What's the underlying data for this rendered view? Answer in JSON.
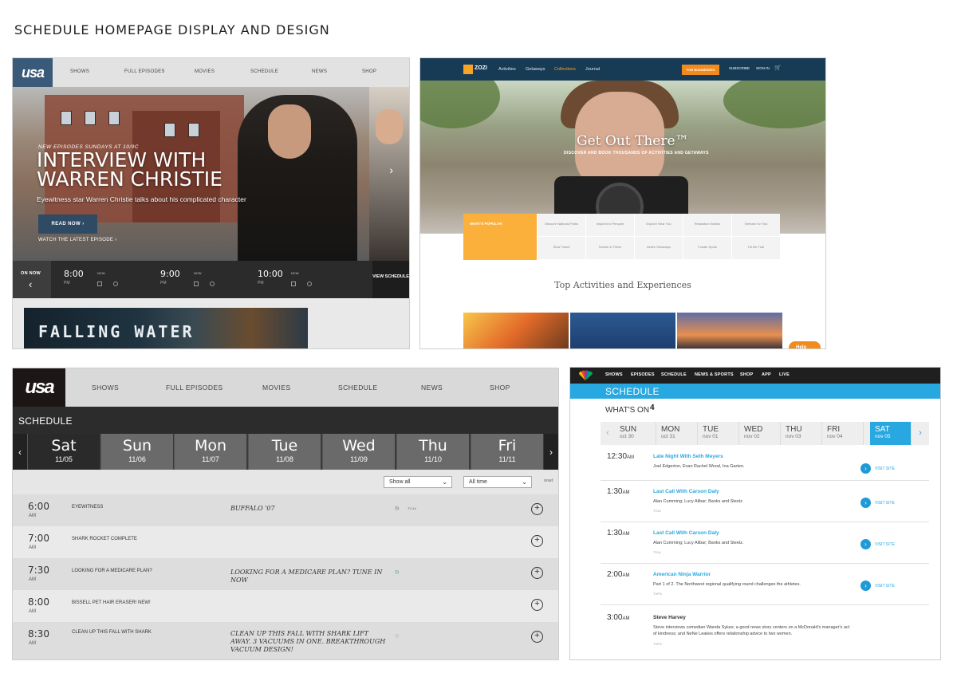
{
  "page": {
    "heading": "SCHEDULE HOMEPAGE DISPLAY AND DESIGN"
  },
  "usa_home": {
    "logo": "usa",
    "nav": [
      "SHOWS",
      "FULL EPISODES",
      "MOVIES",
      "SCHEDULE",
      "NEWS",
      "SHOP"
    ],
    "hero": {
      "kicker": "NEW EPISODES SUNDAYS AT 10/9C",
      "title": "INTERVIEW WITH WARREN CHRISTIE",
      "subtitle": "Eyewitness star Warren Christie talks about his complicated character",
      "read_now": "READ NOW",
      "watch_latest": "WATCH THE LATEST EPISODE"
    },
    "on_now": "ON NOW",
    "slots": [
      {
        "time": "8:00",
        "ampm": "PM",
        "tag": "NCW"
      },
      {
        "time": "9:00",
        "ampm": "PM",
        "tag": "NCW"
      },
      {
        "time": "10:00",
        "ampm": "PM",
        "tag": "NCW"
      }
    ],
    "view_schedule": "VIEW SCHEDULE",
    "banner": "FALLING WATER"
  },
  "zozi": {
    "brand": "ZOZI",
    "nav": [
      "Activities",
      "Getaways",
      "Collections",
      "Journal"
    ],
    "for_business": "FOR BUSINESSES",
    "subscribe": "SUBSCRIBE",
    "sign_in": "SIGN IN",
    "hero_title": "Get Out There™",
    "hero_tagline": "DISCOVER AND BOOK THOUSANDS OF ACTIVITIES AND GETAWAYS",
    "popular": "WHAT'S POPULAR",
    "tabs": [
      "Obscure National Parks",
      "Inspired to Perspire",
      "Explore Near You",
      "Relaxation Station",
      "Vietnam for Two",
      "Slow Travel",
      "Surrise & Thrive",
      "Active Getaways",
      "Foodie Spots",
      "Hit the Trail"
    ],
    "section_title": "Top Activities and Experiences",
    "help": "Help"
  },
  "usa_schedule": {
    "logo": "usa",
    "nav": [
      "SHOWS",
      "FULL EPISODES",
      "MOVIES",
      "SCHEDULE",
      "NEWS",
      "SHOP"
    ],
    "title": "SCHEDULE",
    "days": [
      {
        "name": "Sat",
        "date": "11/05"
      },
      {
        "name": "Sun",
        "date": "11/06"
      },
      {
        "name": "Mon",
        "date": "11/07"
      },
      {
        "name": "Tue",
        "date": "11/08"
      },
      {
        "name": "Wed",
        "date": "11/09"
      },
      {
        "name": "Thu",
        "date": "11/10"
      },
      {
        "name": "Fri",
        "date": "11/11"
      }
    ],
    "filter_show": "Show all",
    "filter_time": "All time",
    "reset": "reset",
    "rows": [
      {
        "time": "6:00",
        "ampm": "AM",
        "show": "EYEWITNESS",
        "episode": "BUFFALO '07",
        "tv": "TV-14"
      },
      {
        "time": "7:00",
        "ampm": "AM",
        "show": "SHARK ROCKET COMPLETE",
        "episode": "",
        "tv": ""
      },
      {
        "time": "7:30",
        "ampm": "AM",
        "show": "LOOKING FOR A MEDICARE PLAN?",
        "episode": "LOOKING FOR A MEDICARE PLAN? TUNE IN NOW",
        "tv": ""
      },
      {
        "time": "8:00",
        "ampm": "AM",
        "show": "BISSELL PET HAIR ERASER! NEW!",
        "episode": "",
        "tv": ""
      },
      {
        "time": "8:30",
        "ampm": "AM",
        "show": "CLEAN UP THIS FALL WITH SHARK",
        "episode": "CLEAN UP THIS FALL WITH SHARK LIFT AWAY. 3 VACUUMS IN ONE. BREAKTHROUGH VACUUM DESIGN!",
        "tv": ""
      }
    ]
  },
  "nbc": {
    "nav": [
      "SHOWS",
      "EPISODES",
      "SCHEDULE",
      "NEWS & SPORTS",
      "SHOP",
      "APP",
      "LIVE"
    ],
    "bar": "SCHEDULE",
    "whats_on": "WHAT'S ON",
    "channel": "4",
    "days": [
      {
        "name": "SUN",
        "date": "oct 30"
      },
      {
        "name": "MON",
        "date": "oct 31"
      },
      {
        "name": "TUE",
        "date": "nov 01"
      },
      {
        "name": "WED",
        "date": "nov 02"
      },
      {
        "name": "THU",
        "date": "nov 03"
      },
      {
        "name": "FRI",
        "date": "nov 04"
      },
      {
        "name": "SAT",
        "date": "nov 05"
      }
    ],
    "visit_site": "VISIT SITE",
    "rows": [
      {
        "time": "12:30",
        "ampm": "AM",
        "title": "Late Night With Seth Meyers",
        "desc": "Joel Edgerton, Evan Rachel Wood, Ina Garten.",
        "rating": ""
      },
      {
        "time": "1:30",
        "ampm": "AM",
        "title": "Last Call With Carson Daly",
        "desc": "Alan Cumming; Lucy Alibar; Banks and Steelz.",
        "rating": "TV14"
      },
      {
        "time": "1:30",
        "ampm": "AM",
        "title": "Last Call With Carson Daly",
        "desc": "Alan Cumming; Lucy Alibar; Banks and Steelz.",
        "rating": "TV14"
      },
      {
        "time": "2:00",
        "ampm": "AM",
        "title": "American Ninja Warrior",
        "desc": "Part 1 of 2. The Northwest regional qualifying round challenges the athletes.",
        "rating": "TVPG"
      },
      {
        "time": "3:00",
        "ampm": "AM",
        "title": "Steve Harvey",
        "desc": "Steve interviews comedian Wanda Sykes; a good news story centers on a McDonald's manager's act of kindness; and NeNe Leakes offers relationship advice to two women.",
        "rating": "TVPG"
      }
    ]
  }
}
